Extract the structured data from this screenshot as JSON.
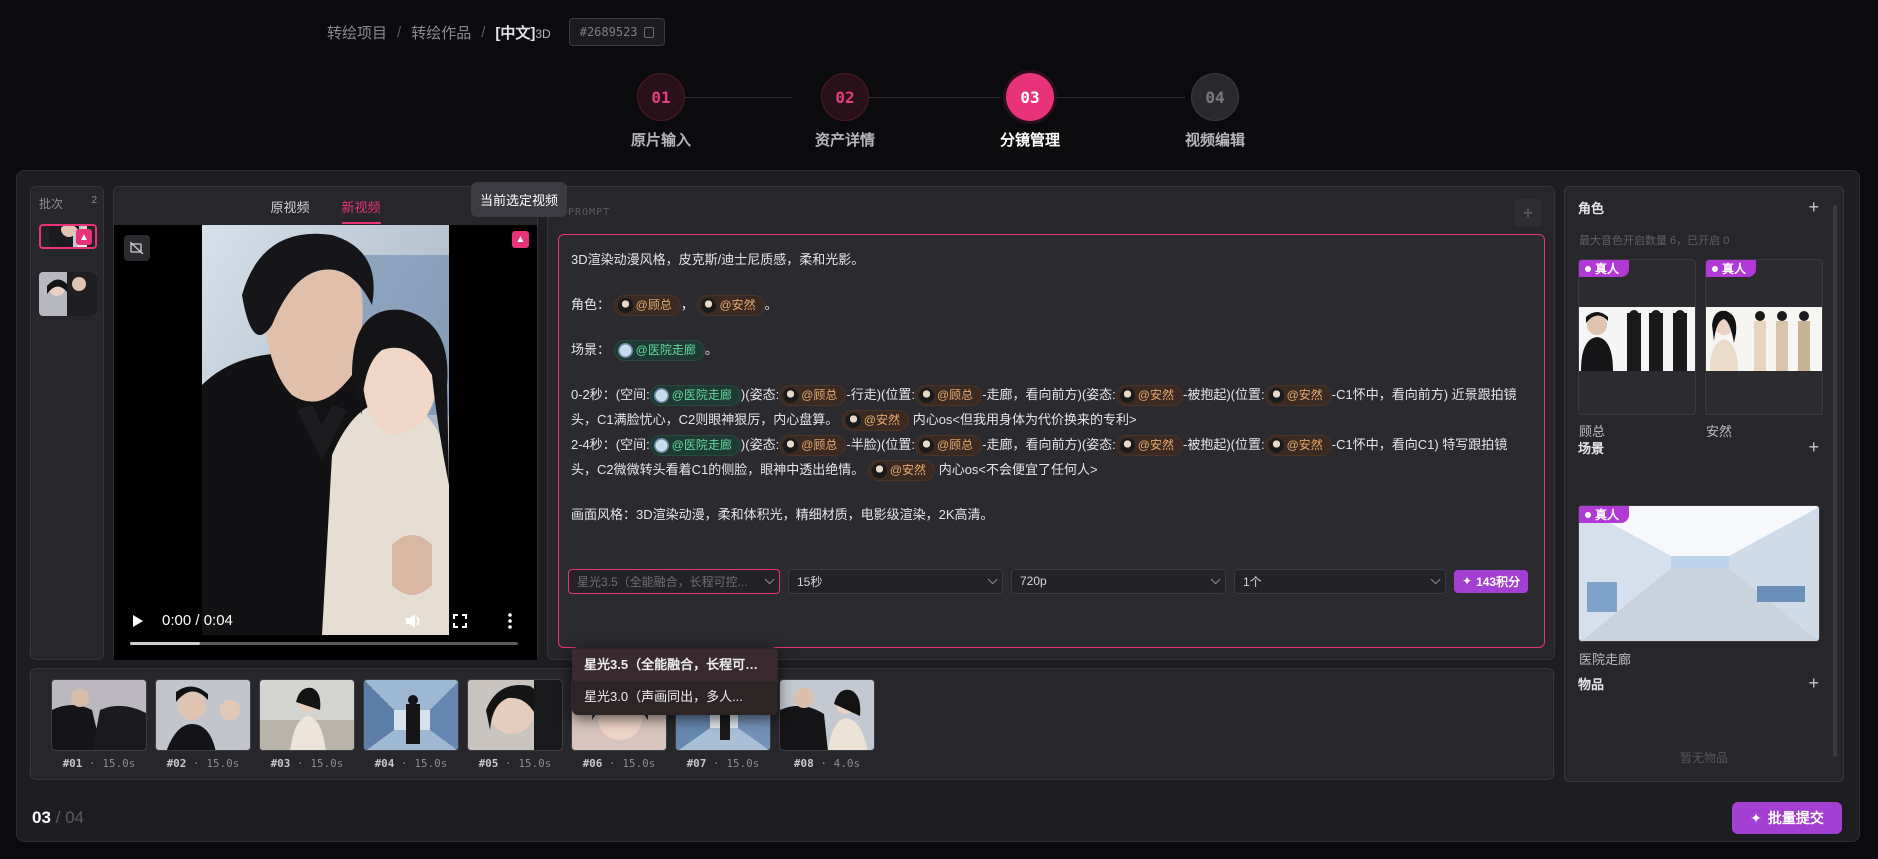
{
  "breadcrumb": {
    "items": [
      "转绘项目",
      "转绘作品"
    ],
    "current": "[中文]",
    "current_suffix": "3D",
    "id_tag": "#2689523"
  },
  "steps": [
    {
      "num": "01",
      "label": "原片输入",
      "state": "done"
    },
    {
      "num": "02",
      "label": "资产详情",
      "state": "done"
    },
    {
      "num": "03",
      "label": "分镜管理",
      "state": "active"
    },
    {
      "num": "04",
      "label": "视频编辑",
      "state": "todo"
    }
  ],
  "batch": {
    "label": "批次",
    "count": "2"
  },
  "video": {
    "tab_original": "原视频",
    "tab_new": "新视频",
    "tooltip": "当前选定视频",
    "time": "0:00 / 0:04",
    "progress": 0.18
  },
  "prompt": {
    "label": "PROMPT",
    "line1": "3D渲染动漫风格，皮克斯/迪士尼质感，柔和光影。",
    "role_label": "角色：",
    "role_sep": "，",
    "role_end": "。",
    "scene_label": "场景：",
    "scene_end": "。",
    "chars": {
      "gu": "@顾总",
      "an": "@安然"
    },
    "scene_chip": "@医院走廊",
    "s1": {
      "a": "0-2秒：(空间:",
      "b": ")(姿态:",
      "c": "-行走)(位置:",
      "d": "-走廊，看向前方)(姿态:",
      "e": "-被抱起)(位置:",
      "f": "-C1怀中，看向前方) 近景跟拍镜头，C1满脸忧心，C2则眼神狠厉，内心盘算。",
      "g": "内心os<但我用身体为代价换来的专利>"
    },
    "s2": {
      "a": "2-4秒：(空间:",
      "b": ")(姿态:",
      "c": "-半脸)(位置:",
      "d": "-走廊，看向前方)(姿态:",
      "e": "-被抱起)(位置:",
      "f": "-C1怀中，看向C1) 特写跟拍镜头，C2微微转头看着C1的侧脸，眼神中透出绝情。",
      "g": "内心os<不会便宜了任何人>"
    },
    "style_line": "画面风格：3D渲染动漫，柔和体积光，精细材质，电影级渲染，2K高清。"
  },
  "toolbar": {
    "model": "星光3.5（全能融合，长程可控...",
    "duration": "15秒",
    "resolution": "720p",
    "count": "1个",
    "credits": "143积分"
  },
  "model_options": [
    "星光3.5（全能融合，长程可控...",
    "星光3.0（声画同出，多人..."
  ],
  "right": {
    "roles_title": "角色",
    "roles_sub": "最大音色开启数量 6，已开启 0",
    "real_tag": "真人",
    "role_cards": [
      {
        "name": "顾总"
      },
      {
        "name": "安然"
      }
    ],
    "scene_title": "场景",
    "scene_cards": [
      {
        "name": "医院走廊"
      }
    ],
    "items_title": "物品",
    "items_empty": "暂无物品"
  },
  "shots": [
    {
      "id": "#01",
      "dur": "15.0s"
    },
    {
      "id": "#02",
      "dur": "15.0s"
    },
    {
      "id": "#03",
      "dur": "15.0s"
    },
    {
      "id": "#04",
      "dur": "15.0s"
    },
    {
      "id": "#05",
      "dur": "15.0s"
    },
    {
      "id": "#06",
      "dur": "15.0s"
    },
    {
      "id": "#07",
      "dur": "15.0s"
    },
    {
      "id": "#08",
      "dur": "4.0s"
    }
  ],
  "shot_sep": " · ",
  "footer": {
    "page_current": "03",
    "page_total": " / 04",
    "submit": "批量提交"
  },
  "colors": {
    "accent": "#e8337a",
    "purple": "#a33fd2",
    "tag": "#b13ad6"
  }
}
